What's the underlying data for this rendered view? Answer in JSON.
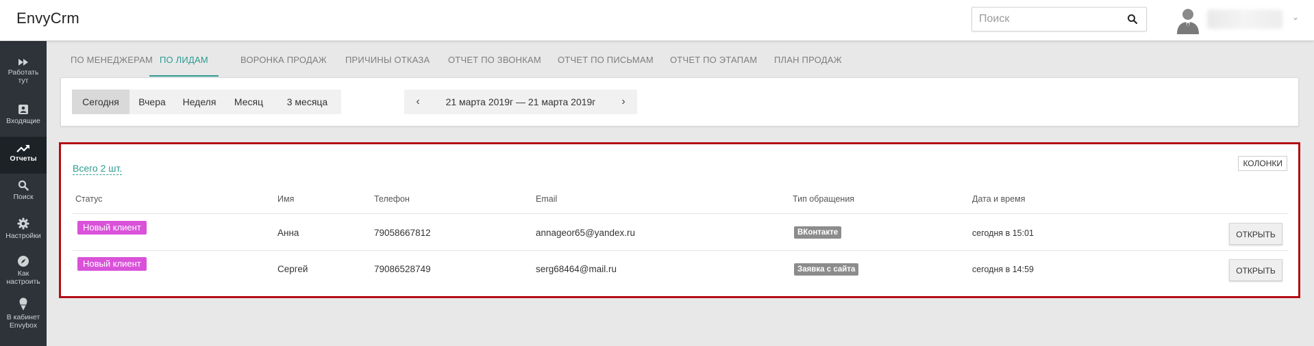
{
  "app": {
    "title": "EnvyCrm"
  },
  "search": {
    "placeholder": "Поиск"
  },
  "sidebar": {
    "items": [
      {
        "label": "Работать тут",
        "icon": "fast-forward-icon"
      },
      {
        "label": "Входящие",
        "icon": "inbox-icon"
      },
      {
        "label": "Отчеты",
        "icon": "trending-up-icon"
      },
      {
        "label": "Поиск",
        "icon": "search-icon"
      },
      {
        "label": "Настройки",
        "icon": "gear-icon"
      },
      {
        "label": "Как настроить",
        "icon": "compass-icon"
      },
      {
        "label": "В кабинет Envybox",
        "icon": "ice-cream-icon"
      }
    ],
    "active_index": 2
  },
  "tabs": [
    {
      "label": "ПО МЕНЕДЖЕРАМ"
    },
    {
      "label": "ПО ЛИДАМ"
    },
    {
      "label": "ВОРОНКА ПРОДАЖ"
    },
    {
      "label": "ПРИЧИНЫ ОТКАЗА"
    },
    {
      "label": "ОТЧЕТ ПО ЗВОНКАМ"
    },
    {
      "label": "ОТЧЕТ ПО ПИСЬМАМ"
    },
    {
      "label": "ОТЧЕТ ПО ЭТАПАМ"
    },
    {
      "label": "ПЛАН ПРОДАЖ"
    }
  ],
  "active_tab": "ПО ЛИДАМ",
  "period": {
    "buttons": [
      {
        "label": "Сегодня"
      },
      {
        "label": "Вчера"
      },
      {
        "label": "Неделя"
      },
      {
        "label": "Месяц"
      },
      {
        "label": "3 месяца"
      }
    ],
    "selected": "Сегодня",
    "range_text": "21 марта 2019г — 21 марта 2019г",
    "prev": "‹",
    "next": "›"
  },
  "leads": {
    "total_text": "Всего 2 шт.",
    "columns_label": "КОЛОНКИ",
    "headers": [
      "Статус",
      "Имя",
      "Телефон",
      "Email",
      "Тип обращения",
      "Дата и время"
    ],
    "rows": [
      {
        "status": "Новый клиент",
        "name": "Анна",
        "phone": "79058667812",
        "email": "annageor65@yandex.ru",
        "type": "ВКонтакте",
        "datetime": "сегодня в 15:01",
        "action": "ОТКРЫТЬ"
      },
      {
        "status": "Новый клиент",
        "name": "Сергей",
        "phone": "79086528749",
        "email": "serg68464@mail.ru",
        "type": "Заявка с сайта",
        "datetime": "сегодня в 14:59",
        "action": "ОТКРЫТЬ"
      }
    ]
  },
  "colors": {
    "accent": "#2c9a8f",
    "status_badge": "#d952d9",
    "type_badge": "#8c8c8c",
    "highlight_border": "#b30c12",
    "sidebar_bg": "#2d3338"
  }
}
